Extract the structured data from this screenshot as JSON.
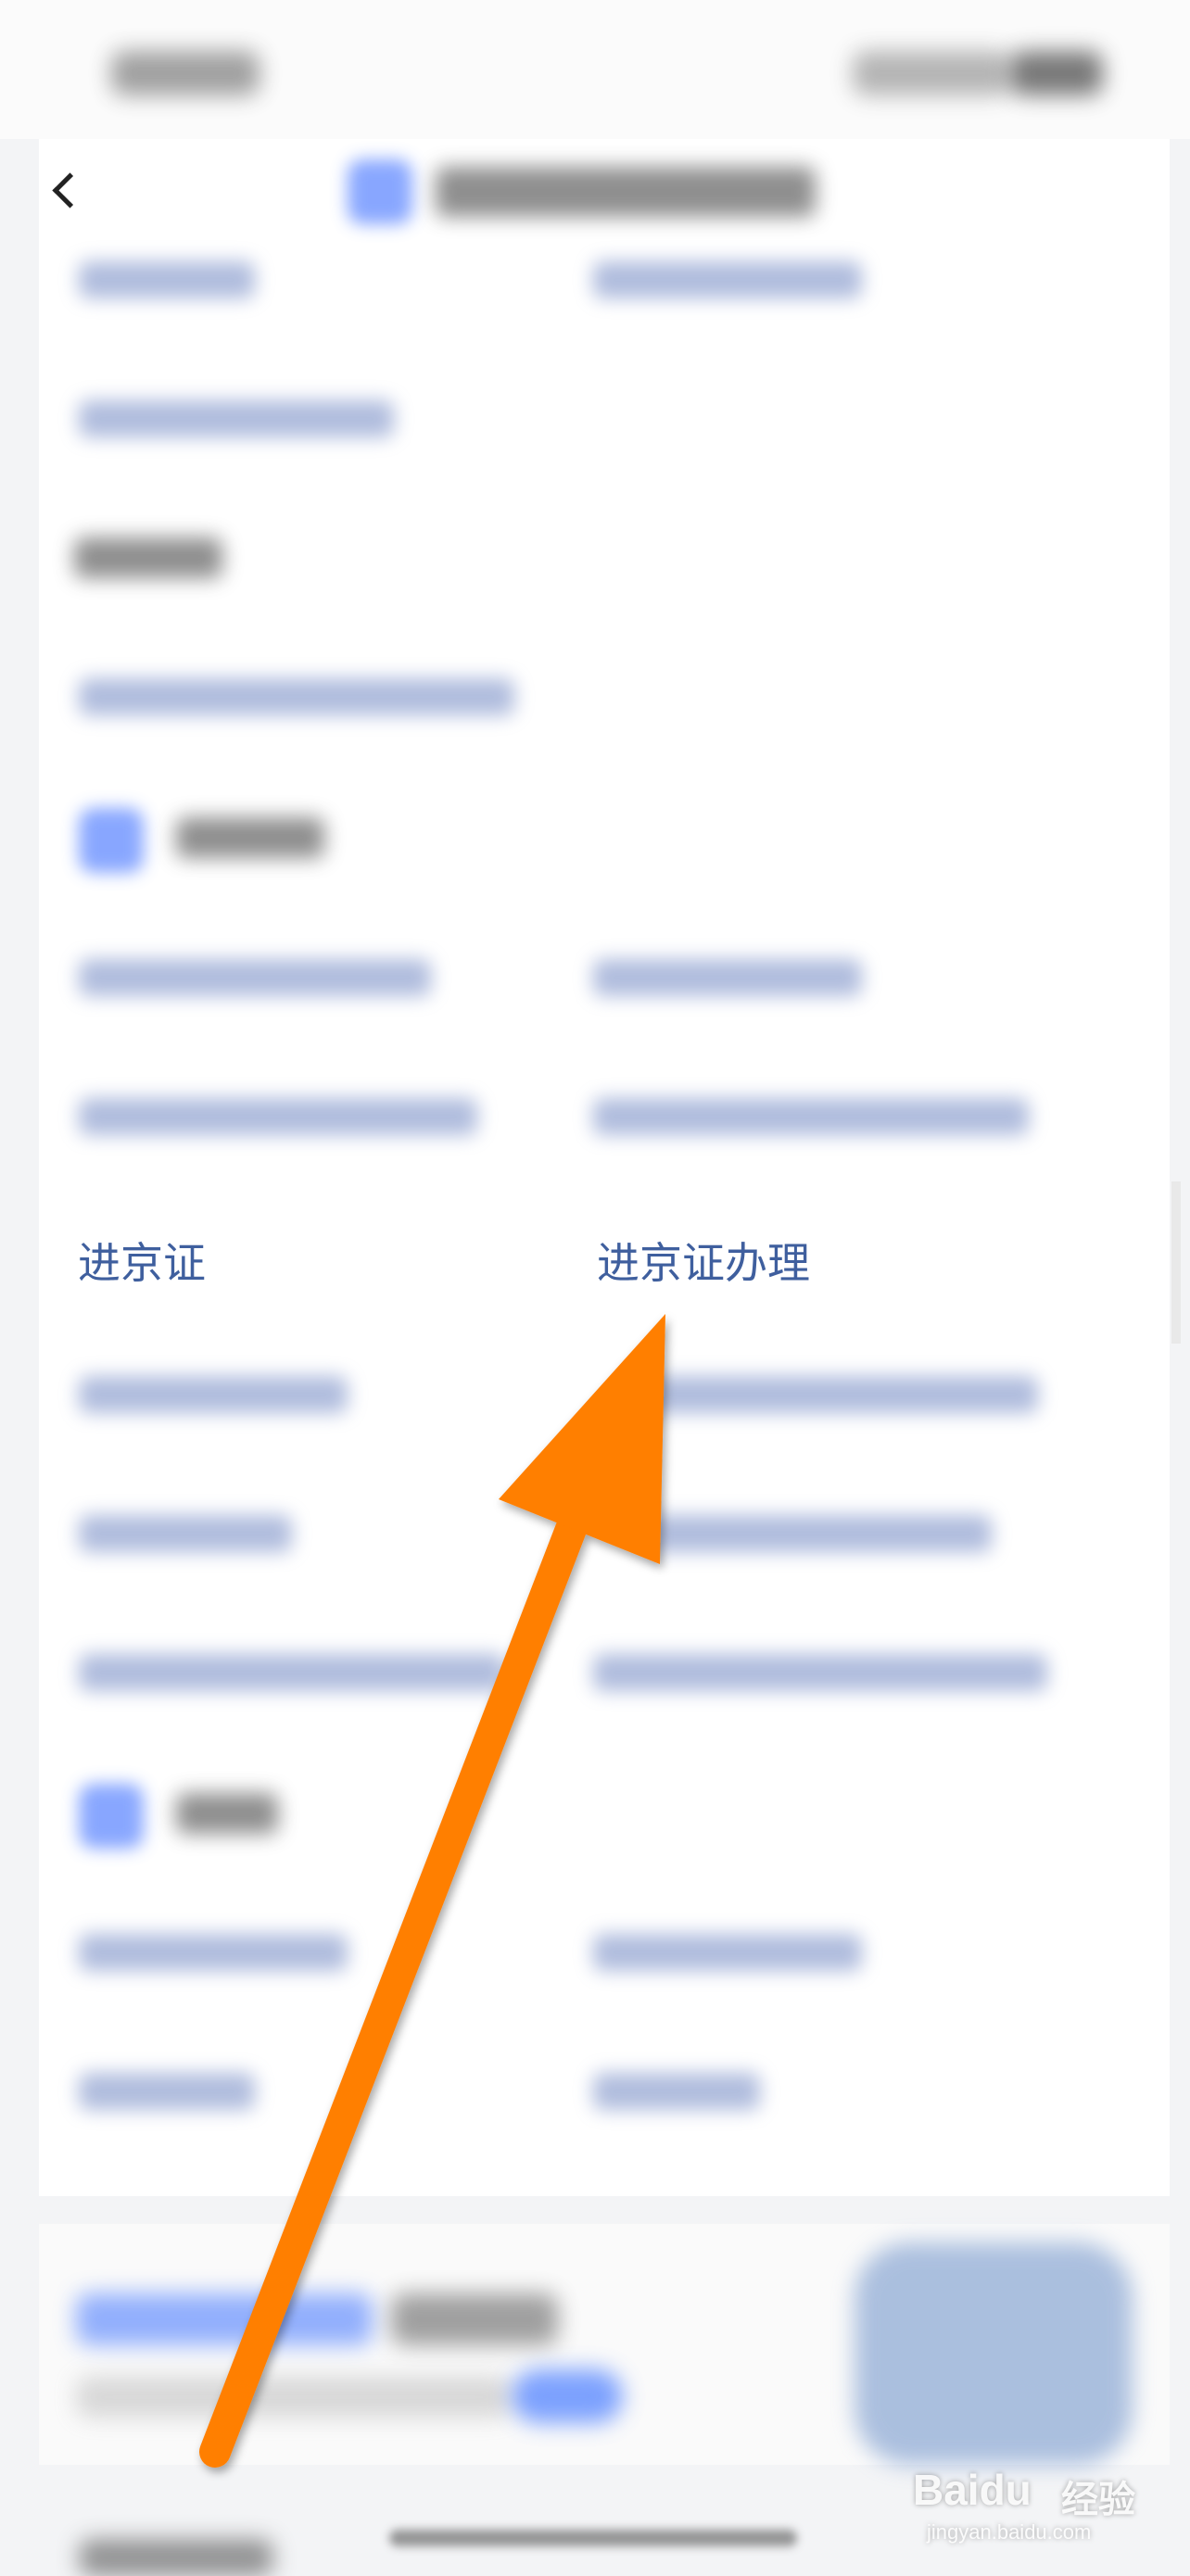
{
  "highlight": {
    "left_link": "进京证",
    "right_link": "进京证办理"
  },
  "watermark": {
    "brand": "Baidu",
    "subtitle": "经验",
    "url": "jingyan.baidu.com"
  },
  "colors": {
    "link": "#3f5f9e",
    "arrow": "#ff7f00",
    "accent": "#6b91ff"
  }
}
